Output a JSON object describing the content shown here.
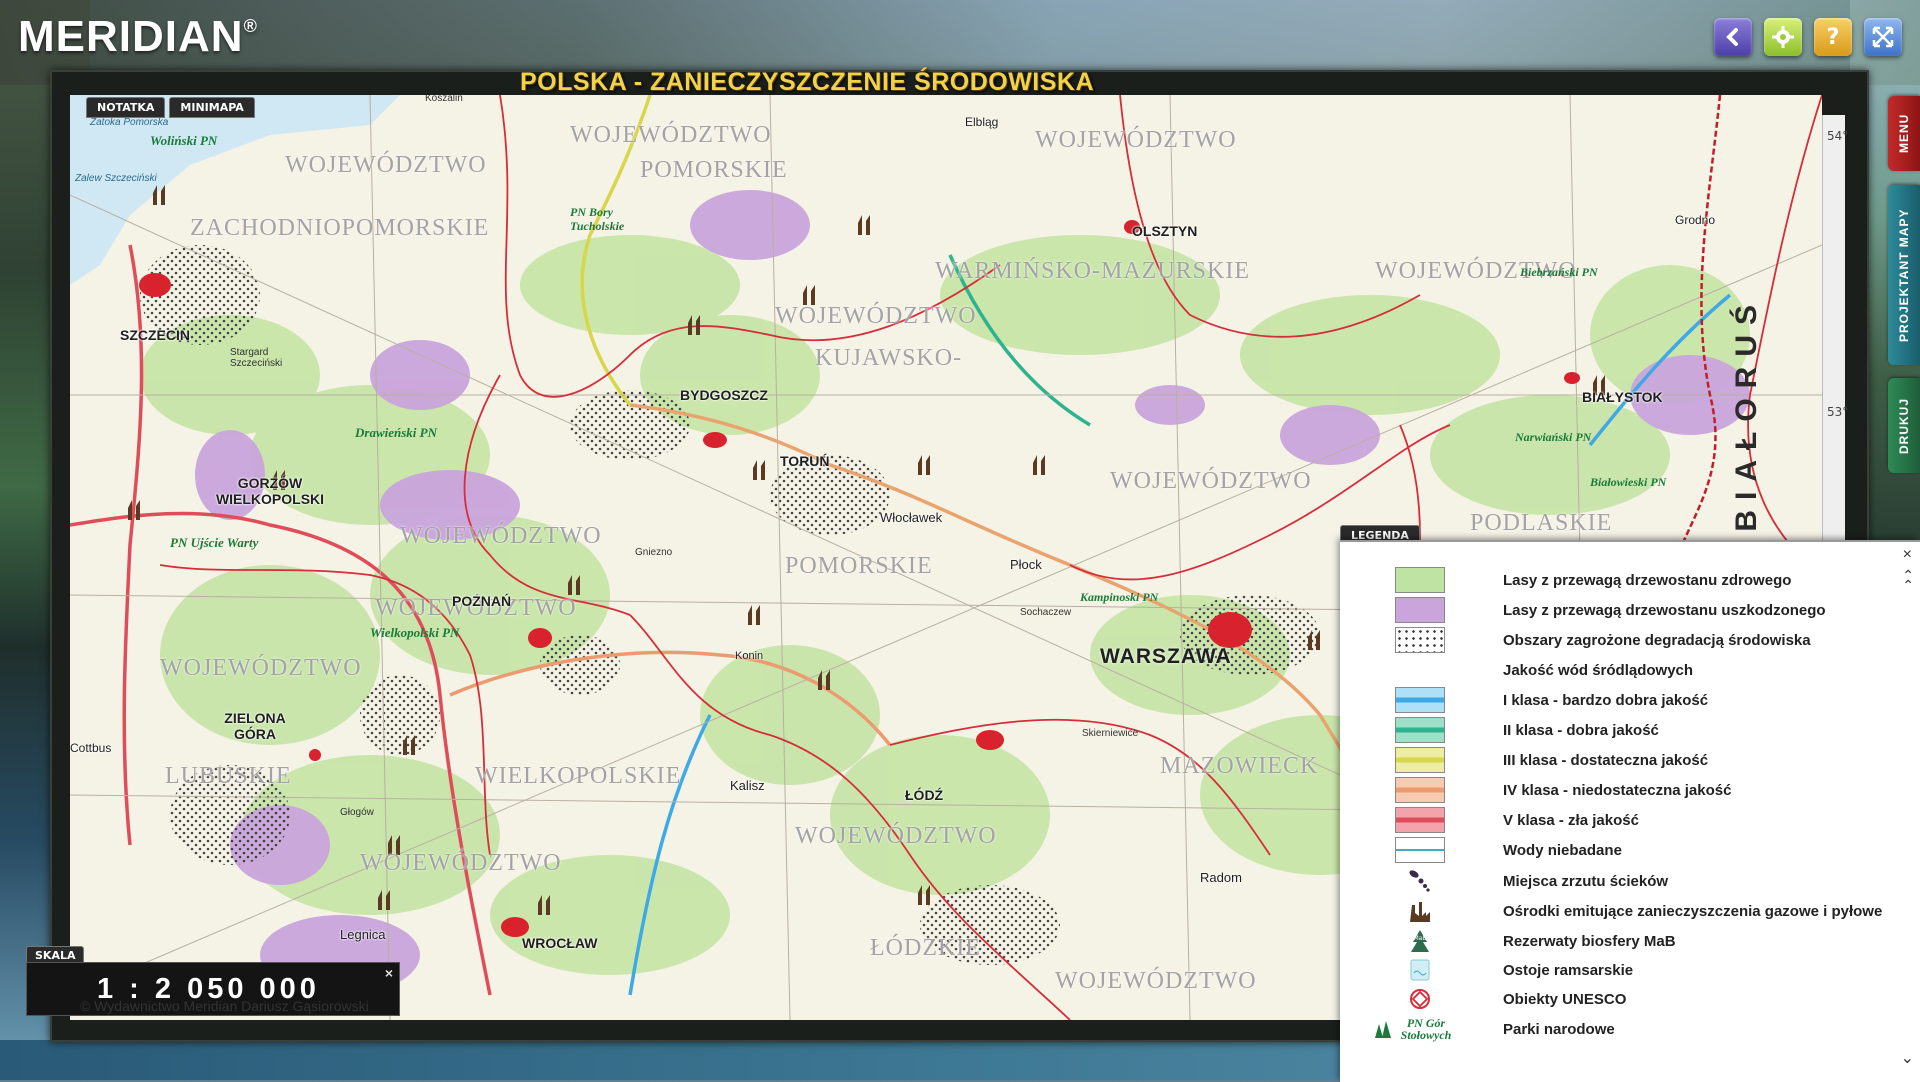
{
  "app": {
    "logo": "MERIDIAN",
    "logo_mark": "®",
    "title": "POLSKA - ZANIECZYSZCZENIE ŚRODOWISKA"
  },
  "toolbar": {
    "back_icon": "back-arrow-icon",
    "settings_icon": "gear-icon",
    "help_label": "?",
    "fullscreen_icon": "fullscreen-icon"
  },
  "map_tabs": [
    "NOTATKA",
    "MINIMAPA"
  ],
  "side_tabs": [
    "MENU",
    "PROJEKTANT MAPY",
    "DRUKUJ"
  ],
  "map": {
    "lat_ticks": [
      "54°",
      "53°"
    ],
    "country": "BIAŁORUŚ",
    "regions": [
      "WOJEWÓDZTWO",
      "ZACHODNIOPOMORSKIE",
      "WOJEWÓDZTWO",
      "POMORSKIE",
      "WOJEWÓDZTWO",
      "WARMIŃSKO-MAZURSKIE",
      "WOJEWÓDZTWO",
      "WOJEWÓDZTWO",
      "KUJAWSKO-",
      "POMORSKIE",
      "WOJEWÓDZTWO",
      "PODLASKIE",
      "WOJEWÓDZTWO",
      "WOJEWÓDZTWO",
      "LUBUSKIE",
      "WIELKOPOLSKIE",
      "MAZOWIECK",
      "WOJEWÓDZTWO",
      "WOJEWÓDZTWO",
      "ŁÓDZKIE",
      "WOJEWÓDZTWO",
      "WOJEWÓDZTWO"
    ],
    "cities": [
      "SZCZECIN",
      "GORZÓW WIELKOPOLSKI",
      "BYDGOSZCZ",
      "TORUŃ",
      "POZNAŃ",
      "ZIELONA GÓRA",
      "WROCŁAW",
      "ŁÓDŹ",
      "OLSZTYN",
      "BIAŁYSTOK",
      "Płock",
      "Włocławek",
      "Kalisz",
      "Radom",
      "Legnica",
      "Elbląg",
      "Grodno",
      "Cottbus",
      "Konin"
    ],
    "capital": "WARSZAWA",
    "parks": [
      "Woliński PN",
      "PN Bory Tucholskie",
      "Drawieński PN",
      "PN Ujście Warty",
      "Wielkopolski PN",
      "Kampinoski PN",
      "Biebrzański PN",
      "Narwiański PN",
      "Białowieski PN"
    ],
    "small_places": [
      "Zatoka Pomorska",
      "Zalew Szczeciński",
      "Koszalin",
      "Stargard Szczeciński",
      "Gniezno",
      "Głogów",
      "Skierniewice",
      "Sochaczew"
    ]
  },
  "legend": {
    "tab": "LEGENDA",
    "close": "×",
    "items": [
      {
        "label": "Lasy z przewagą drzewostanu zdrowego",
        "type": "swatch",
        "color": "#bfe3a3"
      },
      {
        "label": "Lasy z przewagą drzewostanu uszkodzonego",
        "type": "swatch",
        "color": "#c9a5dc"
      },
      {
        "label": "Obszary zagrożone degradacją środowiska",
        "type": "dots"
      },
      {
        "label": "Jakość wód śródlądowych",
        "type": "none"
      },
      {
        "label": "I klasa - bardzo dobra jakość",
        "type": "water",
        "color": "#3fa9e6"
      },
      {
        "label": "II klasa - dobra jakość",
        "type": "water",
        "color": "#2fb38e"
      },
      {
        "label": "III klasa - dostateczna jakość",
        "type": "water",
        "color": "#d8d64a"
      },
      {
        "label": "IV klasa - niedostateczna jakość",
        "type": "water",
        "color": "#ec9b6f"
      },
      {
        "label": "V klasa - zła jakość",
        "type": "water",
        "color": "#e04d5a"
      },
      {
        "label": "Wody niebadane",
        "type": "water",
        "color": "#4aa7c8"
      },
      {
        "label": "Miejsca zrzutu ścieków",
        "type": "icon",
        "icon": "sewage-discharge-icon"
      },
      {
        "label": "Ośrodki emitujące zanieczyszczenia gazowe i pyłowe",
        "type": "icon",
        "icon": "factory-icon"
      },
      {
        "label": "Rezerwaty biosfery MaB",
        "type": "icon",
        "icon": "mab-reserve-icon"
      },
      {
        "label": "Ostoje ramsarskie",
        "type": "icon",
        "icon": "ramsar-icon"
      },
      {
        "label": "Obiekty UNESCO",
        "type": "icon",
        "icon": "unesco-icon"
      },
      {
        "label": "Parki narodowe",
        "type": "icon",
        "icon": "national-park-icon",
        "sample": "PN Gór Stołowych"
      }
    ]
  },
  "scale": {
    "tab": "SKALA",
    "value": "1 : 2 050 000",
    "close": "×"
  },
  "copyright": "© Wydawnictwo Meridian Dariusz Gąsiorowski"
}
